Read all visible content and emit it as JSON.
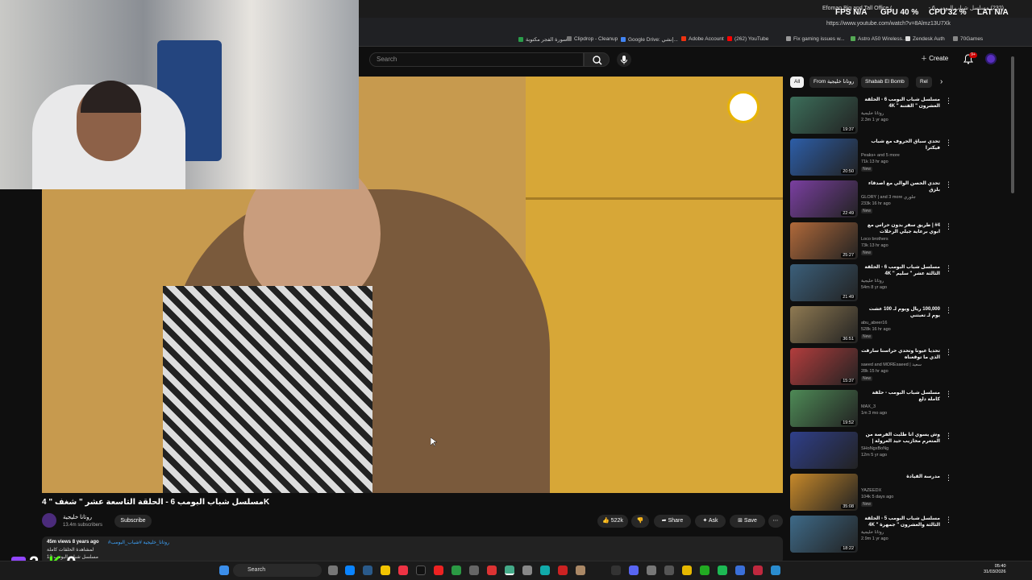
{
  "browser": {
    "tabs": [
      "Efomao Big and Tall Office Ch...",
      "(232) مسلسل شباب البومب 6 -"
    ],
    "url": "https://www.youtube.com/watch?v=8Almz13U7Xk",
    "bookmarks": [
      "سورة الفجر مكتوبة",
      "Clipdrop - Cleanup",
      "Google Drive: إنشي...",
      "Adobe Account",
      "(262) YouTube",
      "Fix gaming issues w...",
      "Astro A50 Wireless...",
      "Zendesk Auth",
      "70Games"
    ]
  },
  "overlay_stats": {
    "fps_label": "FPS",
    "fps": "N/A",
    "gpu_label": "GPU",
    "gpu": "40 %",
    "cpu_label": "CPU",
    "cpu": "32 %",
    "lat_label": "LAT",
    "lat": "N/A"
  },
  "youtube": {
    "search_placeholder": "Search",
    "create_label": "Create",
    "notif_badge": "9+",
    "video_title": "مسلسل شباب البومب 6 - الحلقة التاسعة عشر \" شغف \" 4K",
    "channel": "روتانا خليجية",
    "subscribers": "13.4m subscribers",
    "subscribe_label": "Subscribe",
    "likes": "522k",
    "share_label": "Share",
    "ask_label": "Ask",
    "save_label": "Save",
    "desc_meta": "45m views  8 years ago",
    "desc_tags": "#روتانا_خليجية #شباب_البومب",
    "desc_line1": "لمشاهدة الحلقات كاملة",
    "desc_line2": "12 مسلسل شباب البومب",
    "chips": [
      "All",
      "From روتانا خليجية",
      "Shabab El Bomb",
      "Rel"
    ],
    "recommendations": [
      {
        "title": "مسلسل شباب البومب 6 - الحلقة العشرون \" الفتنة \" 4K",
        "channel": "روتانا خليجية",
        "meta": "2.3m  1 yr ago",
        "duration": "19:37",
        "badge": ""
      },
      {
        "title": "تحدي سباق الحروف مع شباب فيكترا",
        "channel": "Peaks+ and 5 more",
        "meta": "71k  13 hr ago",
        "duration": "20:50",
        "badge": "New"
      },
      {
        "title": "تحدي الحصن الوالي مع اصدقاء بلزق",
        "channel": "GLORY | and 3 more جلوري",
        "meta": "233k  16 hr ago",
        "duration": "22:49",
        "badge": "New"
      },
      {
        "title": "#4 | طريق سفر بدون حراس مع ابوي برعاية جيلي الرحلات",
        "channel": "Loco brothers",
        "meta": "73k  13 hr ago",
        "duration": "25:27",
        "badge": "New"
      },
      {
        "title": "مسلسل شباب البومب 6 - الحلقة الثالثة عشر \" سليم \" 4K",
        "channel": "روتانا خليجية",
        "meta": "54m  8 yr ago",
        "duration": "21:49",
        "badge": ""
      },
      {
        "title": "100,000 ريال ويوم لـ 100 عشت يوم لـ تعبتني",
        "channel": "abu_abeer16",
        "meta": "528k  16 hr ago",
        "duration": "36:51",
        "badge": "New"
      },
      {
        "title": "تحديا عيونا وتحدي حراسنا سارقت الذي ما توقعناه",
        "channel": "saeed and MOREsaeed | سعيد",
        "meta": "28k  15 hr ago",
        "duration": "15:37",
        "badge": "New"
      },
      {
        "title": "مسلسل شباب البومب - حلقة كاملة دلع",
        "channel": "MAX_3",
        "meta": "1m  3 mo ago",
        "duration": "19:52",
        "badge": ""
      },
      {
        "title": "وش يسوي انا طلبت الفرصة من المتعرم مخازيب حيد الغرولة | سكوادو",
        "channel": "SHoNgxBoNg",
        "meta": "12m  5 yr ago",
        "duration": "",
        "badge": ""
      },
      {
        "title": "مدرسة القيادة",
        "channel": "YAZEEDX",
        "meta": "104k  5 days ago",
        "duration": "35:08",
        "badge": "New"
      },
      {
        "title": "مسلسل شباب البومب 5 - الحلقة الثالثة والعشرون \" جمهرة \" 4K",
        "channel": "روتانا خليجية",
        "meta": "2.9m  1 yr ago",
        "duration": "18:22",
        "badge": ""
      }
    ]
  },
  "scoreboard": {
    "left": "2",
    "right": "0"
  },
  "taskbar": {
    "search": "Search",
    "time": "05:40",
    "date": "31/03/2026"
  }
}
